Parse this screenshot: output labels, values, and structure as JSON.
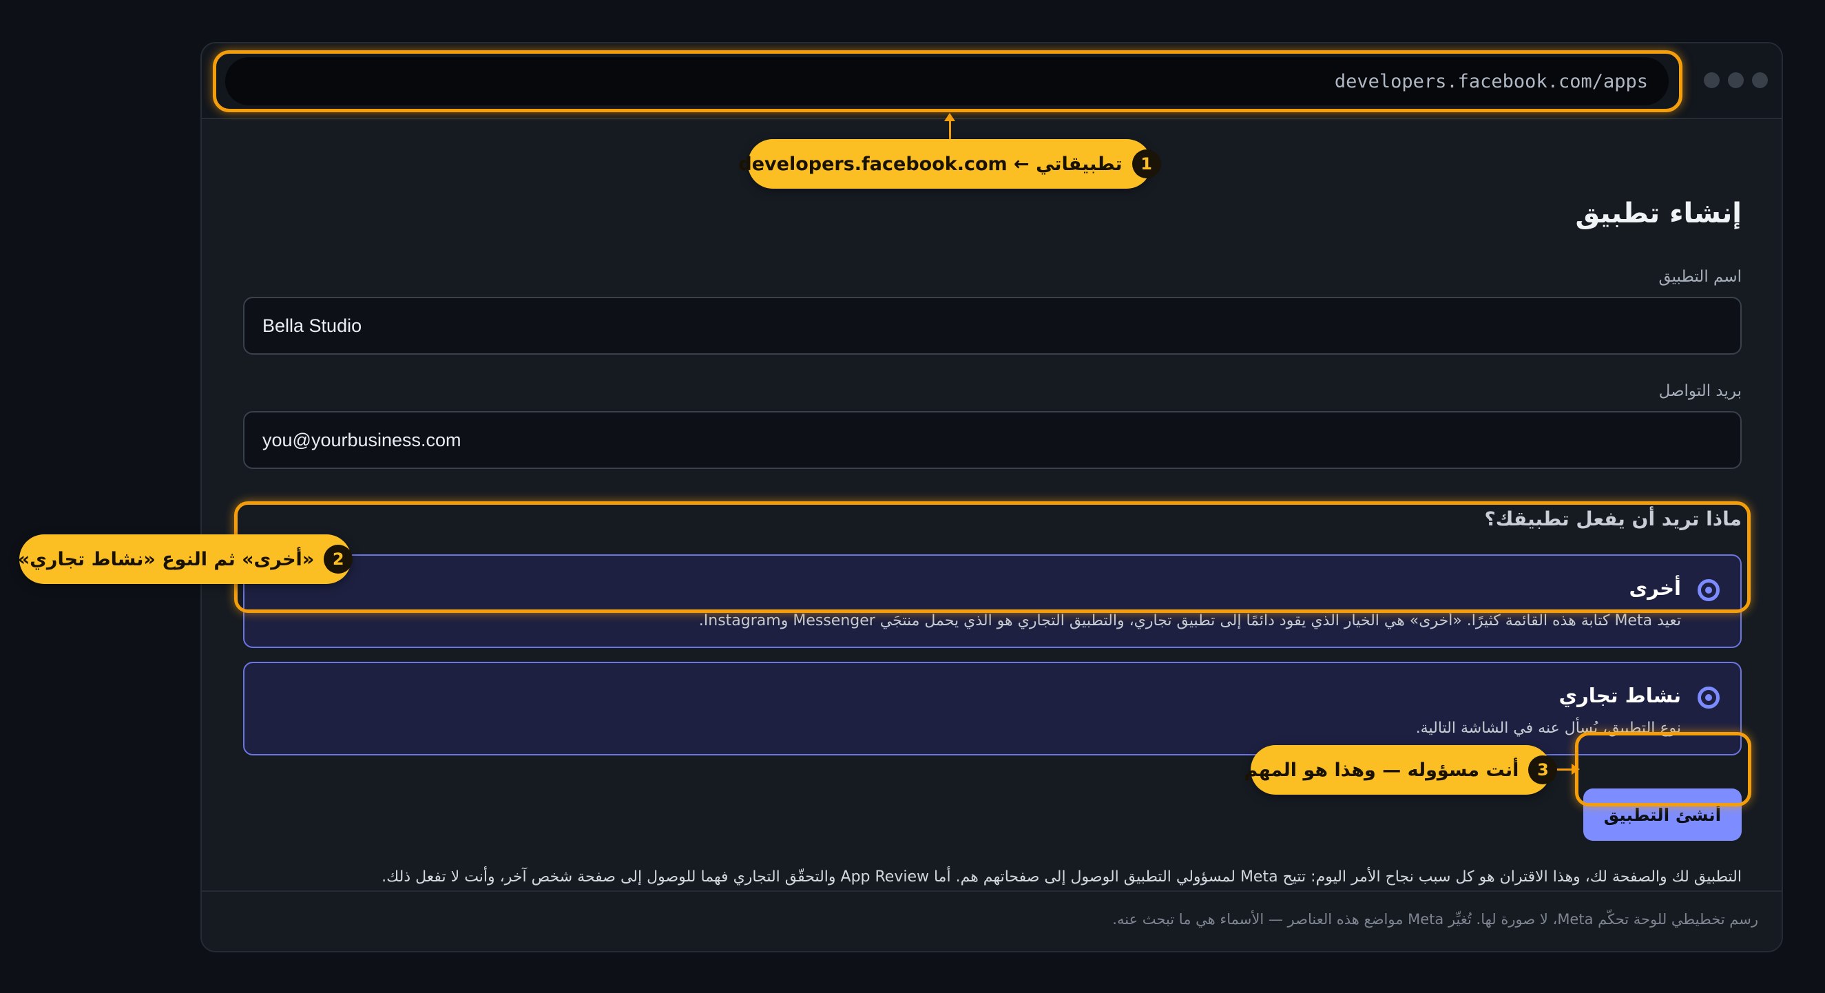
{
  "browser": {
    "url": "developers.facebook.com/apps"
  },
  "form": {
    "title": "إنشاء تطبيق",
    "app_name_label": "اسم التطبيق",
    "app_name_value": "Bella Studio",
    "email_label": "بريد التواصل",
    "email_value": "you@yourbusiness.com",
    "purpose_title": "ماذا تريد أن يفعل تطبيقك؟",
    "options": [
      {
        "title": "أخرى",
        "description": "تعيد Meta كتابة هذه القائمة كثيرًا. «أخرى» هي الخيار الذي يقود دائمًا إلى تطبيق تجاري، والتطبيق التجاري هو الذي يحمل منتجَي Messenger وInstagram."
      },
      {
        "title": "نشاط تجاري",
        "description": "نوع التطبيق، يُسأل عنه في الشاشة التالية."
      }
    ],
    "submit_label": "أنشئ التطبيق",
    "note": "التطبيق لك والصفحة لك، وهذا الاقتران هو كل سبب نجاح الأمر اليوم: تتيح Meta لمسؤولي التطبيق الوصول إلى صفحاتهم هم. أما App Review والتحقّق التجاري فهما للوصول إلى صفحة شخص آخر، وأنت لا تفعل ذلك."
  },
  "footer": {
    "text": "رسم تخطيطي للوحة تحكّم Meta، لا صورة لها. تُغيِّر Meta مواضع هذه العناصر — الأسماء هي ما تبحث عنه."
  },
  "callouts": [
    {
      "number": "1",
      "text": "تطبيقاتي ← developers.facebook.com"
    },
    {
      "number": "2",
      "text": "«أخرى» ثم النوع «نشاط تجاري»"
    },
    {
      "number": "3",
      "text": "أنت مسؤوله — وهذا هو المهم"
    }
  ],
  "colors": {
    "highlight": "#f59e0b",
    "callout_bg": "#fbbf24",
    "accent": "#7d8dff",
    "background": "#0d1117"
  }
}
